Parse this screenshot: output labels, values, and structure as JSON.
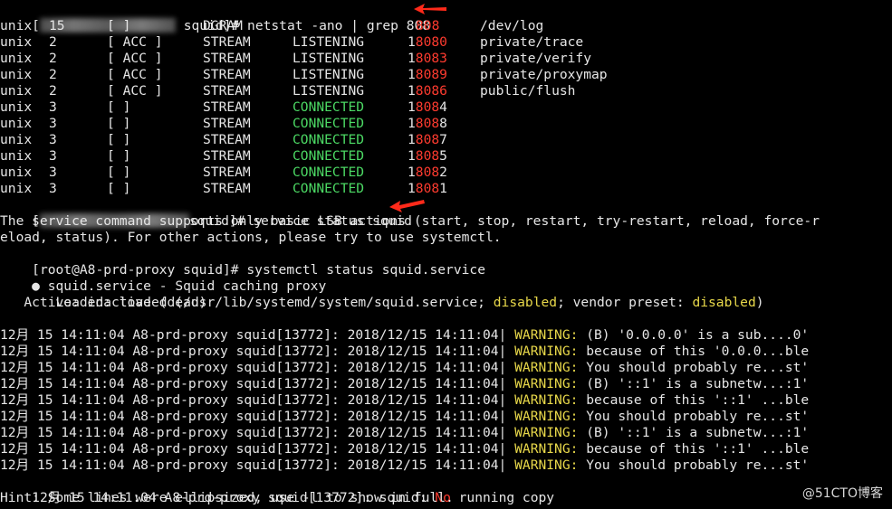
{
  "prompt1": {
    "open": "[",
    "redacted": "user@host",
    "close": " squid]# ",
    "command": "netstat -ano | grep 808"
  },
  "netstat_rows": [
    {
      "proto": "unix",
      "refcnt": "15",
      "flags": "[ ]",
      "type": "DGRAM",
      "state": "",
      "state_color": "",
      "port_a": "",
      "port_b": "808",
      "path": "/dev/log"
    },
    {
      "proto": "unix",
      "refcnt": "2",
      "flags": "[ ACC ]",
      "type": "STREAM",
      "state": "LISTENING",
      "state_color": "",
      "port_a": "1",
      "port_b": "8080",
      "path": "private/trace"
    },
    {
      "proto": "unix",
      "refcnt": "2",
      "flags": "[ ACC ]",
      "type": "STREAM",
      "state": "LISTENING",
      "state_color": "",
      "port_a": "1",
      "port_b": "8083",
      "path": "private/verify"
    },
    {
      "proto": "unix",
      "refcnt": "2",
      "flags": "[ ACC ]",
      "type": "STREAM",
      "state": "LISTENING",
      "state_color": "",
      "port_a": "1",
      "port_b": "8089",
      "path": "private/proxymap"
    },
    {
      "proto": "unix",
      "refcnt": "2",
      "flags": "[ ACC ]",
      "type": "STREAM",
      "state": "LISTENING",
      "state_color": "",
      "port_a": "1",
      "port_b": "8086",
      "path": "public/flush"
    },
    {
      "proto": "unix",
      "refcnt": "3",
      "flags": "[ ]",
      "type": "STREAM",
      "state": "CONNECTED",
      "state_color": "green",
      "port_a": "1",
      "port_b": "808",
      "port_c": "4",
      "path": ""
    },
    {
      "proto": "unix",
      "refcnt": "3",
      "flags": "[ ]",
      "type": "STREAM",
      "state": "CONNECTED",
      "state_color": "green",
      "port_a": "1",
      "port_b": "808",
      "port_c": "8",
      "path": ""
    },
    {
      "proto": "unix",
      "refcnt": "3",
      "flags": "[ ]",
      "type": "STREAM",
      "state": "CONNECTED",
      "state_color": "green",
      "port_a": "1",
      "port_b": "808",
      "port_c": "7",
      "path": ""
    },
    {
      "proto": "unix",
      "refcnt": "3",
      "flags": "[ ]",
      "type": "STREAM",
      "state": "CONNECTED",
      "state_color": "green",
      "port_a": "1",
      "port_b": "808",
      "port_c": "5",
      "path": ""
    },
    {
      "proto": "unix",
      "refcnt": "3",
      "flags": "[ ]",
      "type": "STREAM",
      "state": "CONNECTED",
      "state_color": "green",
      "port_a": "1",
      "port_b": "808",
      "port_c": "2",
      "path": ""
    },
    {
      "proto": "unix",
      "refcnt": "3",
      "flags": "[ ]",
      "type": "STREAM",
      "state": "CONNECTED",
      "state_color": "green",
      "port_a": "1",
      "port_b": "808",
      "port_c": "1",
      "path": ""
    }
  ],
  "prompt2": {
    "open": "[",
    "redacted": "user@host",
    "close": "squid]# ",
    "command": "service status squid"
  },
  "service_msg": [
    "The service command supports only basic LSB actions (start, stop, restart, try-restart, reload, force-r",
    "eload, status). For other actions, please try to use systemctl."
  ],
  "prompt3": {
    "text": "[root@A8-prd-proxy squid]# ",
    "command": "systemctl status squid.service"
  },
  "unit": {
    "bullet": "●",
    "title": " squid.service - Squid caching proxy"
  },
  "loaded": {
    "prefix": "   Loaded: loaded (/usr/lib/systemd/system/squid.service; ",
    "state": "disabled",
    "mid": "; vendor preset: ",
    "preset": "disabled",
    "end": ")"
  },
  "active": {
    "text": "   Active: inactive (dead)"
  },
  "log_prefix": "12月 15 14:11:04 A8-prd-proxy squid[13772]: 2018/12/15 14:11:04| ",
  "warning_label": "WARNING:",
  "logs": [
    " (B) '0.0.0.0' is a sub....0'",
    " because of this '0.0.0...ble",
    " You should probably re...st'",
    " (B) '::1' is a subnetw...:1'",
    " because of this '::1' ...ble",
    " You should probably re...st'",
    " (B) '::1' is a subnetw...:1'",
    " because of this '::1' ...ble",
    " You should probably re...st'"
  ],
  "last_log": {
    "prefix": "12月 15 14:11:04 A8-prd-proxy squid[13772]: squid: ",
    "no": "No",
    "rest": " running copy"
  },
  "hint": "Hint: Some lines were ellipsized, use -l to show in full.",
  "watermark": "@51CTO博客",
  "colors": {
    "background": "#000000",
    "text": "#e6e6e6",
    "red": "#ff3b2f",
    "green": "#4cd964",
    "yellow": "#e8d84a"
  }
}
